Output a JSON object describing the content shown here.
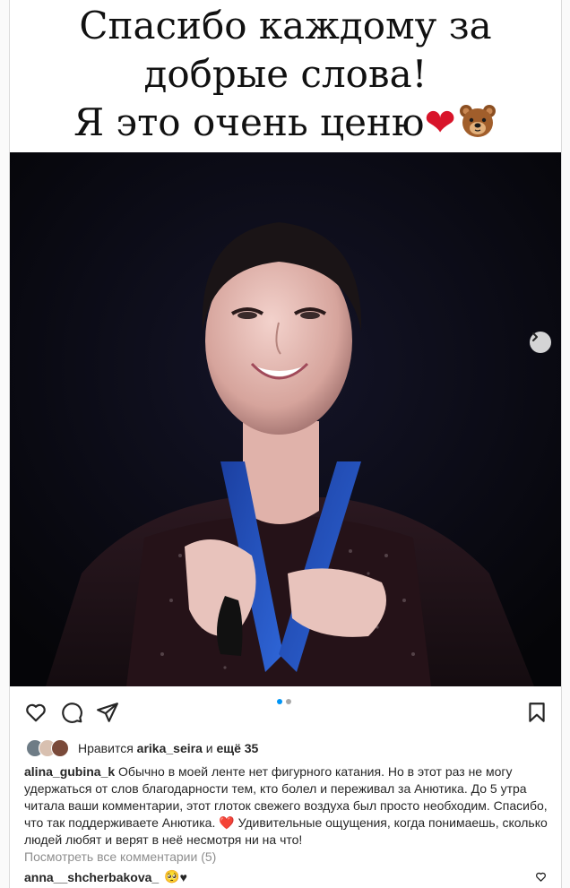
{
  "post": {
    "image_caption": {
      "line1": "Спасибо каждому за",
      "line2": "добрые слова!",
      "line3": "Я это очень ценю",
      "heart_emoji": "❤",
      "bear_icon": "bear-face-emoji"
    },
    "carousel": {
      "slides": 2,
      "active_slide": 1,
      "next_icon": "chevron-right-icon"
    },
    "actions": {
      "like_icon": "heart-icon",
      "comment_icon": "comment-icon",
      "share_icon": "send-icon",
      "save_icon": "bookmark-icon"
    },
    "likes": {
      "prefix": "Нравится",
      "user": "arika_seira",
      "conj": "и",
      "others": "ещё 35"
    },
    "caption": {
      "username": "alina_gubina_k",
      "text_part1": "Обычно в моей ленте нет фигурного катания. Но в этот раз не могу удержаться от слов благодарности тем, кто болел и переживал за Анютика. До 5 утра читала ваши комментарии, этот глоток свежего воздуха был просто необходим. Спасибо, что так поддерживаете Анютика.",
      "heart": "❤️",
      "text_part2": "Удивительные ощущения, когда понимаешь, сколько людей любят и верят в неё несмотря ни на что!"
    },
    "view_comments": "Посмотреть все комментарии (5)",
    "comment": {
      "username": "anna__shcherbakova_",
      "emoji": "🥺",
      "heart": "♥"
    },
    "colors": {
      "accent": "#0095f6",
      "text": "#262626",
      "muted": "#8e8e8e",
      "heart_red": "#ed4956"
    }
  }
}
